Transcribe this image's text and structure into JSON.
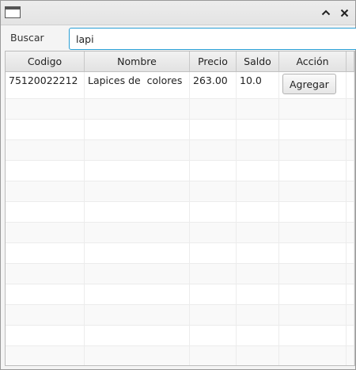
{
  "window": {
    "icon": "window-icon",
    "controls": [
      "maximize-icon",
      "close-icon"
    ]
  },
  "search": {
    "label": "Buscar",
    "value": "lapi"
  },
  "table": {
    "columns": [
      "Codigo",
      "Nombre",
      "Precio",
      "Saldo",
      "Acción"
    ],
    "rows": [
      {
        "codigo": "75120022212",
        "nombre": "Lapices de  colores",
        "precio": "263.00",
        "saldo": "10.0",
        "accion": "Agregar"
      }
    ],
    "empty_rows": 13
  },
  "colors": {
    "focus_accent": "#2a9fd6"
  }
}
